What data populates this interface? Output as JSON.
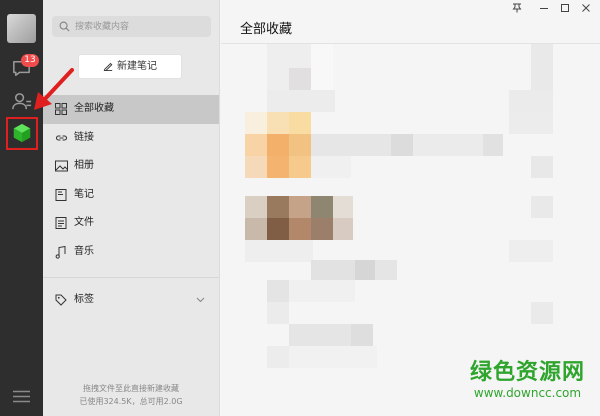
{
  "rail": {
    "unread_badge": "13",
    "icons": [
      "avatar",
      "chat-icon",
      "contacts-icon",
      "favorites-cube-icon",
      "menu-icon"
    ]
  },
  "annotation": {
    "highlight_color": "#e0201f"
  },
  "sidebar": {
    "search_placeholder": "搜索收藏内容",
    "new_note_label": "新建笔记",
    "items": [
      {
        "label": "全部收藏",
        "icon": "grid-icon",
        "active": true
      },
      {
        "label": "链接",
        "icon": "link-icon"
      },
      {
        "label": "相册",
        "icon": "photo-icon"
      },
      {
        "label": "笔记",
        "icon": "note-icon"
      },
      {
        "label": "文件",
        "icon": "file-icon"
      },
      {
        "label": "音乐",
        "icon": "music-icon"
      }
    ],
    "tags_label": "标签",
    "footer_line1": "拖拽文件至此直接新建收藏",
    "footer_line2": "已使用324.5K，总可用2.0G"
  },
  "main": {
    "title": "全部收藏",
    "window_controls": [
      "pin",
      "minimize",
      "maximize",
      "close"
    ]
  },
  "watermark": {
    "text": "绿色资源网",
    "url": "www.downcc.com"
  },
  "colors": {
    "rail": "#2e2e2e",
    "sidebar": "#e8e8e8",
    "active_item": "#c8c8c8",
    "badge": "#f04c4c",
    "watermark": "#2fa52e"
  }
}
